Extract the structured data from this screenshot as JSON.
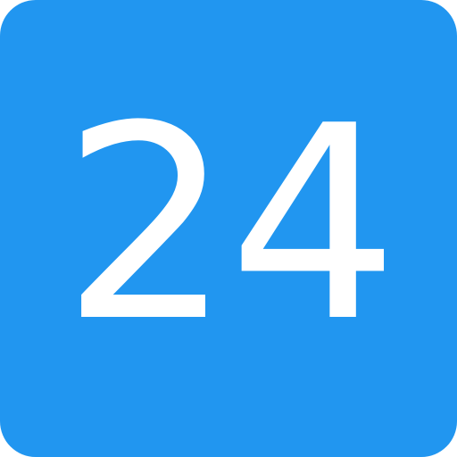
{
  "icon": {
    "text": "24",
    "background_color": "#2196f0",
    "text_color": "#ffffff"
  }
}
